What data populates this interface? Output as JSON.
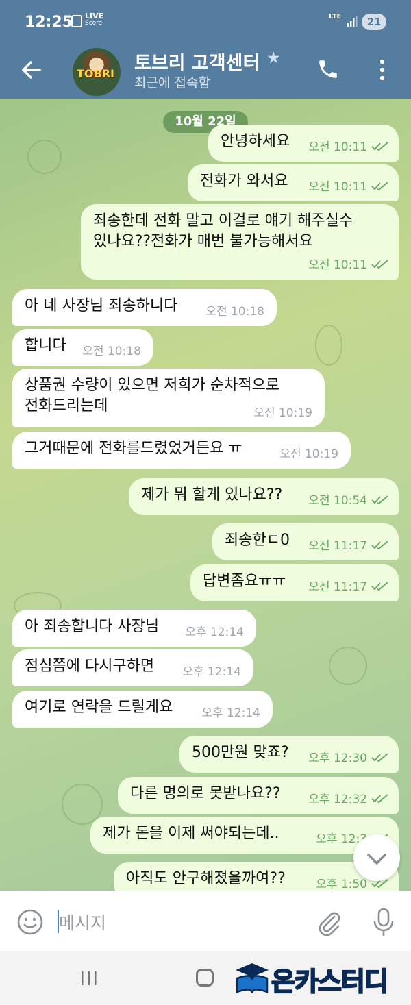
{
  "status_bar": {
    "time": "12:25",
    "live_top": "LIVE",
    "live_bottom": "Score",
    "network": "LTE",
    "battery": "21"
  },
  "header": {
    "avatar_text": "TOBRI",
    "title": "토브리 고객센터",
    "subtitle": "최근에 접속함"
  },
  "chat": {
    "date": "10월 22일",
    "messages": [
      {
        "dir": "out",
        "text": "안녕하세요",
        "time": "오전 10:11"
      },
      {
        "dir": "out",
        "text": "전화가 와서요",
        "time": "오전 10:11"
      },
      {
        "dir": "out",
        "text": "죄송한데 전화 말고 이걸로 얘기 해주실수\n있나요??전화가 매번 불가능해서요",
        "time": "오전 10:11"
      },
      {
        "dir": "in",
        "text": "아 네 사장님 죄송하니다",
        "time": "오전 10:18"
      },
      {
        "dir": "in",
        "text": "합니다",
        "time": "오전 10:18"
      },
      {
        "dir": "in",
        "text": "상품권 수량이 있으면 저희가 순차적으로\n전화드리는데",
        "time": "오전 10:19"
      },
      {
        "dir": "in",
        "text": "그거때문에 전화를드렸었거든요 ㅠ",
        "time": "오전 10:19"
      },
      {
        "dir": "out",
        "text": "제가 뭐 할게 있나요??",
        "time": "오전 10:54"
      },
      {
        "dir": "out",
        "text": "죄송한ㄷ0",
        "time": "오전 11:17"
      },
      {
        "dir": "out",
        "text": "답변좀요ㅠㅠ",
        "time": "오전 11:17"
      },
      {
        "dir": "in",
        "text": "아 죄송합니다 사장님",
        "time": "오후 12:14"
      },
      {
        "dir": "in",
        "text": "점심쯤에 다시구하면",
        "time": "오후 12:14"
      },
      {
        "dir": "in",
        "text": "여기로 연락을 드릴게요",
        "time": "오후 12:14"
      },
      {
        "dir": "out",
        "text": "500만원 맞죠?",
        "time": "오후 12:30"
      },
      {
        "dir": "out",
        "text": "다른 명의로 못받나요??",
        "time": "오후 12:32"
      },
      {
        "dir": "out",
        "text": "제가 돈을 이제 써야되는데..",
        "time": "오후 12:3"
      },
      {
        "dir": "out",
        "text": "아직도 안구해졌을까여??",
        "time": "오후 1:50"
      }
    ]
  },
  "input": {
    "placeholder": "메시지"
  },
  "watermark": {
    "text": "온카스터디"
  },
  "colors": {
    "header": "#557da0",
    "bubble_out": "#effdde",
    "bubble_in": "#ffffff",
    "time_out": "#6ba865",
    "time_in": "#a0a6ab"
  }
}
